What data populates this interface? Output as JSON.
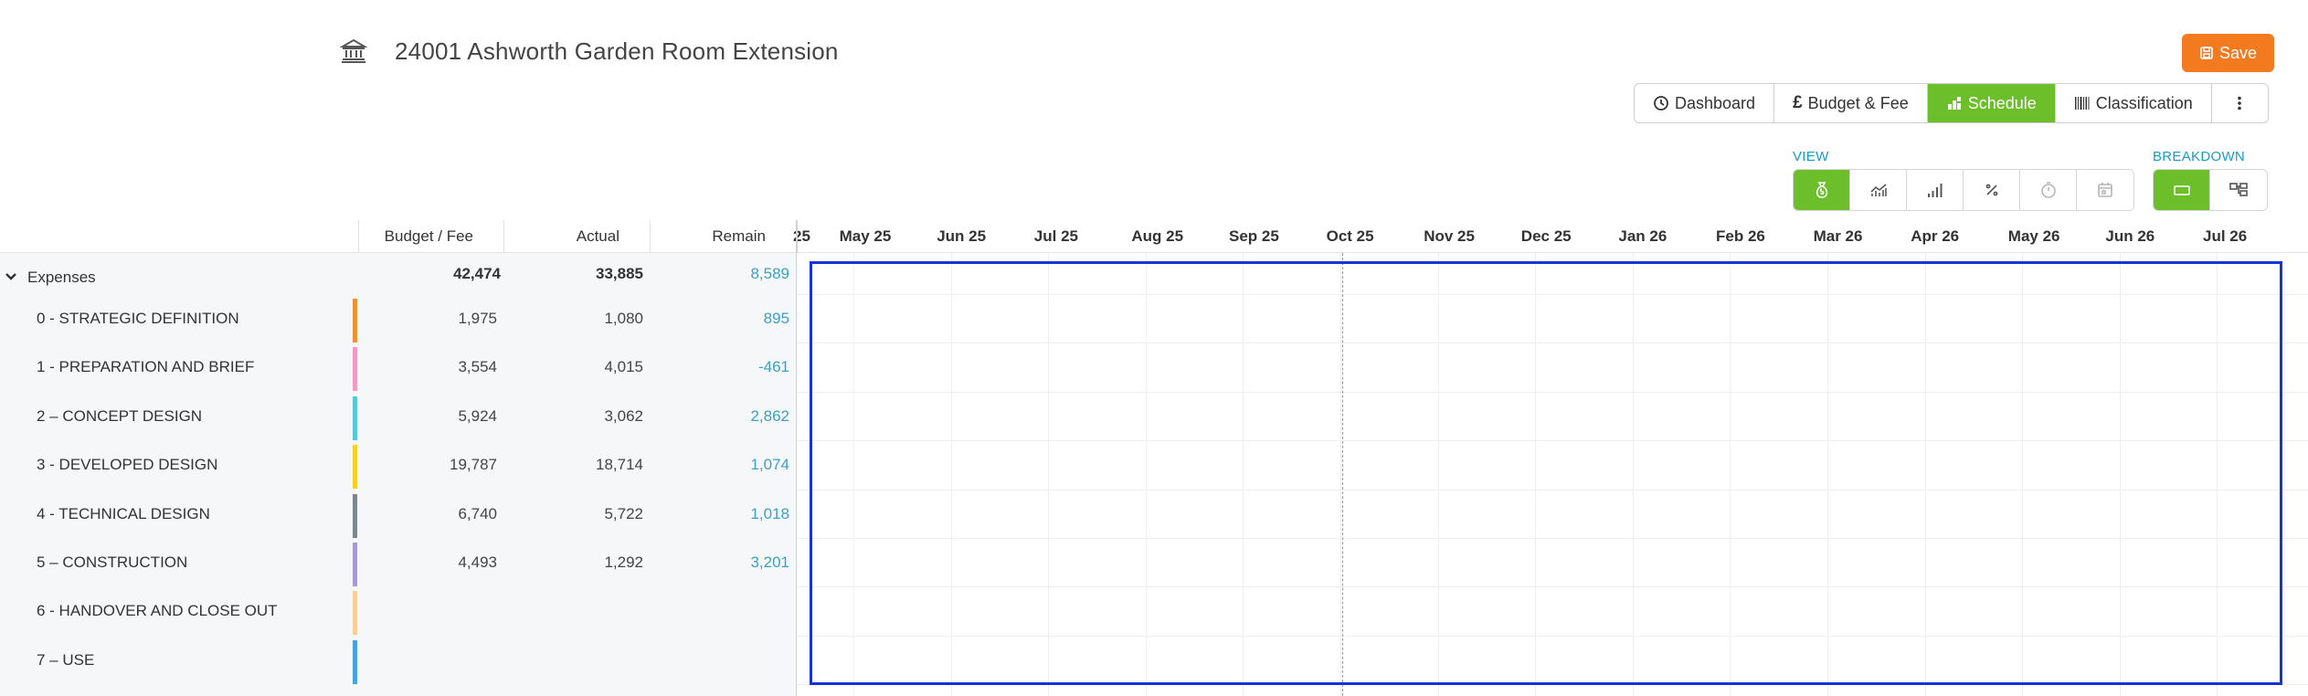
{
  "project": {
    "title": "24001 Ashworth Garden Room Extension",
    "icon": "bank-icon"
  },
  "save_label": "Save",
  "tabs": [
    {
      "label": "Dashboard",
      "icon": "clock-icon",
      "active": false
    },
    {
      "label": "Budget & Fee",
      "icon": "pound-icon",
      "active": false
    },
    {
      "label": "Schedule",
      "icon": "schedule-icon",
      "active": true
    },
    {
      "label": "Classification",
      "icon": "barcode-icon",
      "active": false
    }
  ],
  "view": {
    "label": "VIEW"
  },
  "breakdown": {
    "label": "BREAKDOWN"
  },
  "columns": {
    "budget": "Budget / Fee",
    "actual": "Actual",
    "remain": "Remain"
  },
  "months": [
    "25",
    "May 25",
    "Jun 25",
    "Jul 25",
    "Aug 25",
    "Sep 25",
    "Oct 25",
    "Nov 25",
    "Dec 25",
    "Jan 26",
    "Feb 26",
    "Mar 26",
    "Apr 26",
    "May 26",
    "Jun 26",
    "Jul 26"
  ],
  "total": {
    "label": "Expenses",
    "budget": "42,474",
    "actual": "33,885",
    "remain": "8,589"
  },
  "rows": [
    {
      "label": "0 - STRATEGIC DEFINITION",
      "budget": "1,975",
      "actual": "1,080",
      "remain": "895",
      "color": "#f0913a"
    },
    {
      "label": "1 - PREPARATION AND BRIEF",
      "budget": "3,554",
      "actual": "4,015",
      "remain": "-461",
      "color": "#f29ac3"
    },
    {
      "label": "2 – CONCEPT DESIGN",
      "budget": "5,924",
      "actual": "3,062",
      "remain": "2,862",
      "color": "#5ac8d2"
    },
    {
      "label": "3 - DEVELOPED DESIGN",
      "budget": "19,787",
      "actual": "18,714",
      "remain": "1,074",
      "color": "#f5cf2a"
    },
    {
      "label": "4 - TECHNICAL DESIGN",
      "budget": "6,740",
      "actual": "5,722",
      "remain": "1,018",
      "color": "#7d8791"
    },
    {
      "label": "5 – CONSTRUCTION",
      "budget": "4,493",
      "actual": "1,292",
      "remain": "3,201",
      "color": "#a99ad6"
    },
    {
      "label": "6 - HANDOVER AND CLOSE OUT",
      "budget": "",
      "actual": "",
      "remain": "",
      "color": "#f6cf9a"
    },
    {
      "label": "7 – USE",
      "budget": "",
      "actual": "",
      "remain": "",
      "color": "#4aa3e0"
    }
  ]
}
